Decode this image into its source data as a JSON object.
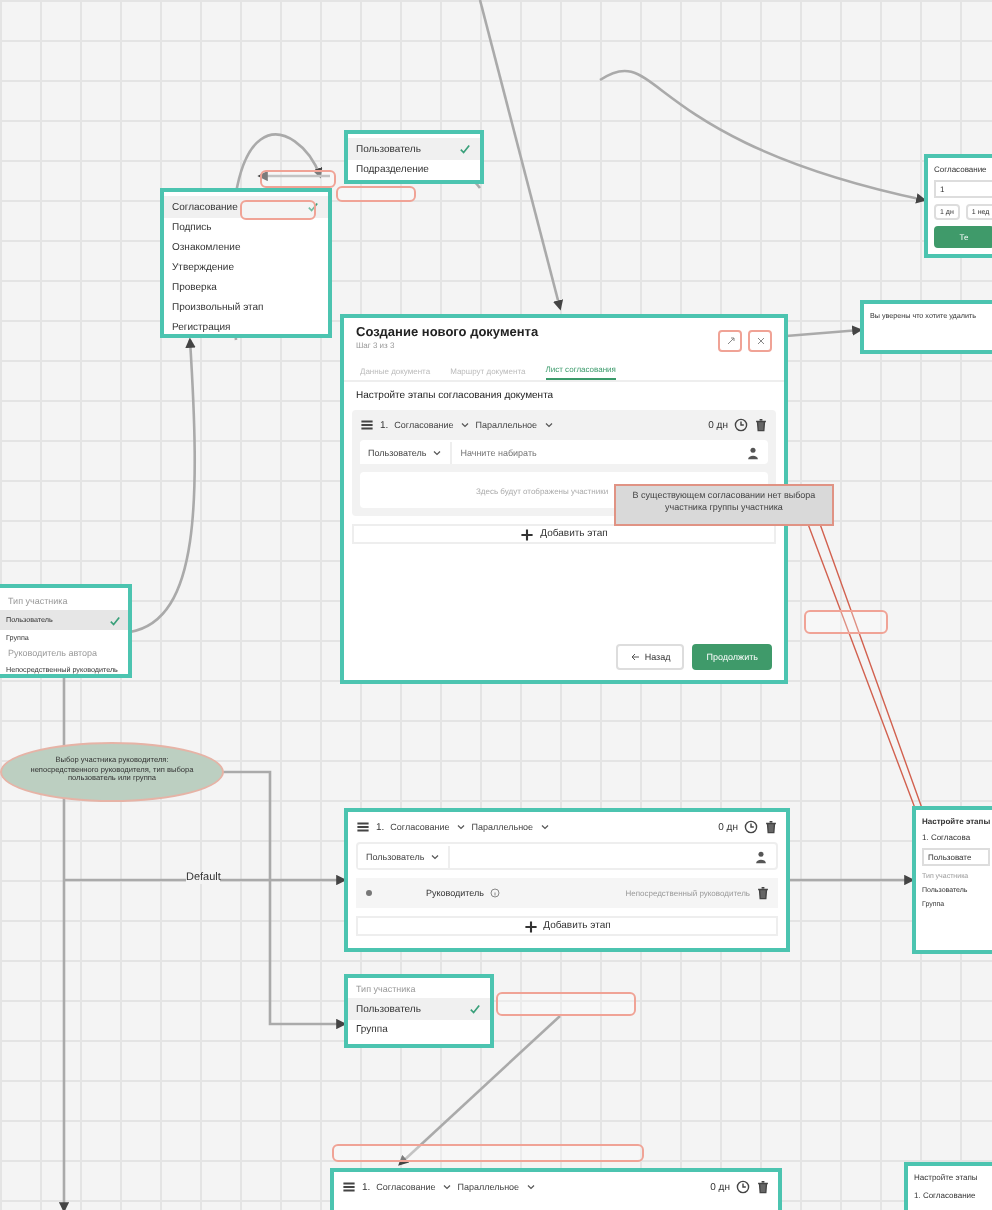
{
  "participant_menu_top": {
    "items": [
      {
        "label": "Пользователь",
        "selected": true
      },
      {
        "label": "Подразделение",
        "selected": false
      }
    ]
  },
  "stage_type_menu": {
    "items": [
      {
        "label": "Согласование",
        "selected": true
      },
      {
        "label": "Подпись",
        "selected": false
      },
      {
        "label": "Ознакомление",
        "selected": false
      },
      {
        "label": "Утверждение",
        "selected": false
      },
      {
        "label": "Проверка",
        "selected": false
      },
      {
        "label": "Произвольный этап",
        "selected": false
      },
      {
        "label": "Регистрация",
        "selected": false
      }
    ]
  },
  "modal": {
    "title": "Создание нового документа",
    "subtitle": "Шаг 3 из 3",
    "tabs": [
      {
        "label": "Данные документа",
        "selected": false
      },
      {
        "label": "Маршрут документа",
        "selected": false
      },
      {
        "label": "Лист согласования",
        "selected": true
      }
    ],
    "heading": "Настройте этапы согласования документа",
    "stage": {
      "number": "1.",
      "type": "Согласование",
      "mode": "Параллельное",
      "duration": "0 дн"
    },
    "participant_type": "Пользователь",
    "search": {
      "placeholder": "Начните набирать"
    },
    "empty_note": "Здесь будут отображены участники",
    "add_stage": "Добавить этап",
    "back": "Назад",
    "continue": "Продолжить"
  },
  "comment": "В существующем согласовании нет выбора участника группы участника",
  "deadline_panel": {
    "title": "Согласование",
    "value": "1",
    "options": [
      "1 дн",
      "1 нед"
    ],
    "button": "Те"
  },
  "confirm_panel": {
    "text": "Вы уверены что хотите удалить"
  },
  "participant_menu_left": {
    "items": [
      {
        "kind": "header",
        "label": "Тип участника"
      },
      {
        "kind": "option",
        "label": "Пользователь",
        "selected": true
      },
      {
        "kind": "option",
        "label": "Группа",
        "selected": false
      },
      {
        "kind": "header",
        "label": "Руководитель автора"
      },
      {
        "kind": "option",
        "label": "Непосредственный руководитель",
        "selected": false
      }
    ]
  },
  "cloud_note": "Выбор участника руководителя: непосредственного руководителя, тип выбора пользователь или группа",
  "edge_label": "Default",
  "stage_card": {
    "number": "1.",
    "type": "Согласование",
    "mode": "Параллельное",
    "duration": "0 дн",
    "participant_type": "Пользователь",
    "participant": "Руководитель",
    "participant_detail": "Непосредственный руководитель",
    "add_stage": "Добавить этап"
  },
  "participant_menu_bottom": {
    "header": "Тип участника",
    "items": [
      {
        "label": "Пользователь",
        "selected": true
      },
      {
        "label": "Группа",
        "selected": false
      }
    ]
  },
  "right_panel": {
    "heading": "Настройте этапы",
    "stage": "1. Согласова",
    "participant_type": "Пользовате",
    "menu_header": "Тип участника",
    "items": [
      "Пользователь",
      "Группа"
    ]
  },
  "bottom_stage": {
    "number": "1.",
    "type": "Согласование",
    "mode": "Параллельное",
    "duration": "0 дн"
  },
  "bottom_right_panel": {
    "heading": "Настройте этапы",
    "stage": "1. Согласование"
  }
}
